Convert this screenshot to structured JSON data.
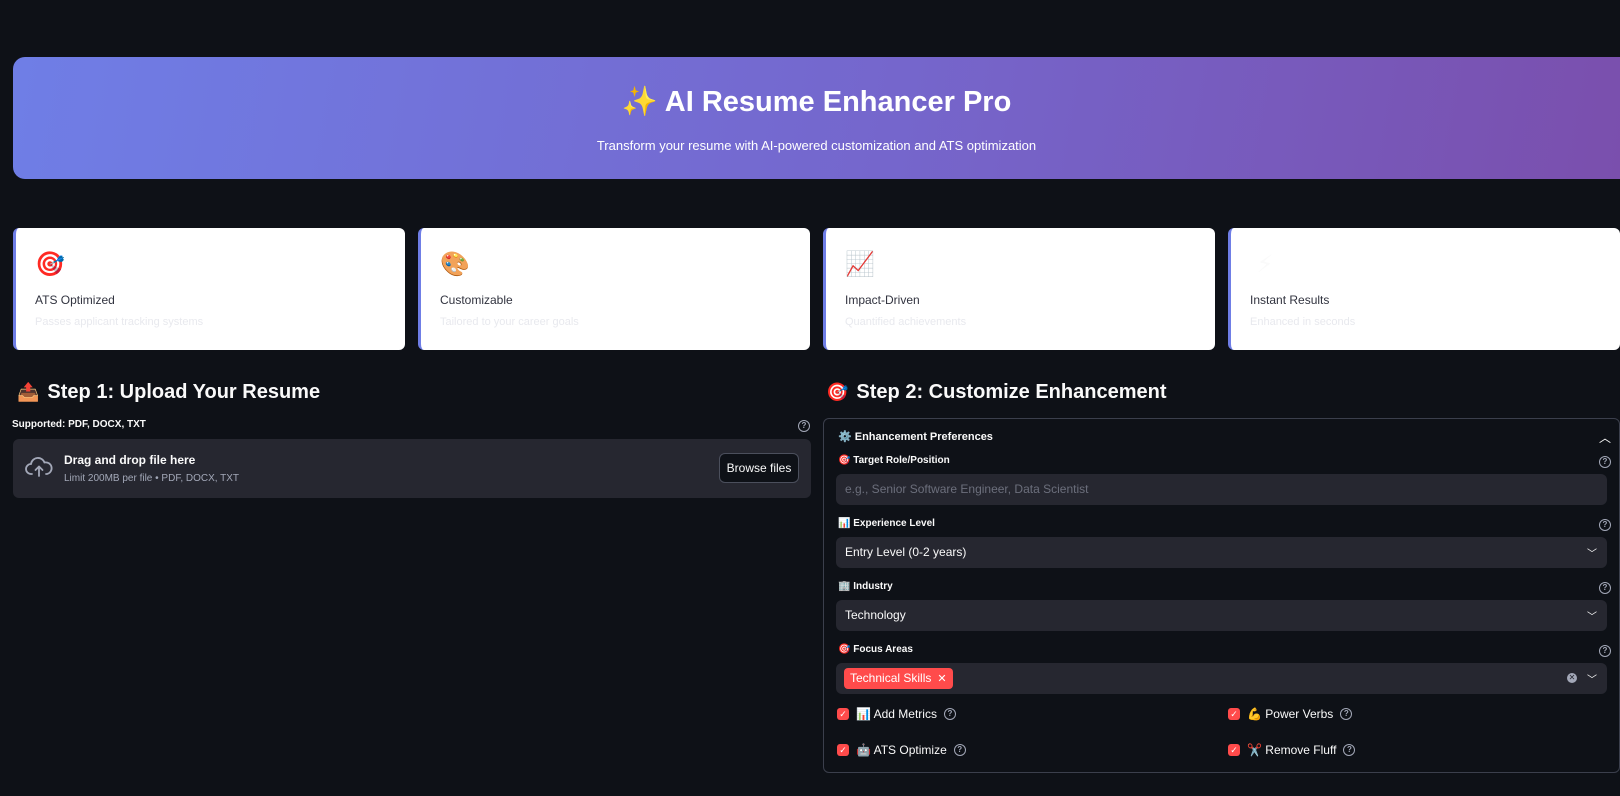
{
  "hero": {
    "title": "✨ AI Resume Enhancer Pro",
    "subtitle": "Transform your resume with AI-powered customization and ATS optimization"
  },
  "features": [
    {
      "icon": "🎯",
      "icon_name": "target-icon",
      "title": "ATS Optimized",
      "desc": "Passes applicant tracking systems"
    },
    {
      "icon": "🎨",
      "icon_name": "palette-icon",
      "title": "Customizable",
      "desc": "Tailored to your career goals"
    },
    {
      "icon": "📈",
      "icon_name": "chart-up-icon",
      "title": "Impact-Driven",
      "desc": "Quantified achievements"
    },
    {
      "icon": "⚡",
      "icon_name": "lightning-icon",
      "title": "Instant Results",
      "desc": "Enhanced in seconds"
    }
  ],
  "step1": {
    "icon": "📤",
    "title": "Step 1: Upload Your Resume",
    "label": "Supported: PDF, DOCX, TXT",
    "drop_title": "Drag and drop file here",
    "drop_sub": "Limit 200MB per file • PDF, DOCX, TXT",
    "browse": "Browse files"
  },
  "step2": {
    "icon": "🎯",
    "title": "Step 2: Customize Enhancement",
    "expander": "⚙️ Enhancement Preferences",
    "role_label": "🎯 Target Role/Position",
    "role_placeholder": "e.g., Senior Software Engineer, Data Scientist",
    "exp_label": "📊 Experience Level",
    "exp_value": "Entry Level (0-2 years)",
    "industry_label": "🏢 Industry",
    "industry_value": "Technology",
    "focus_label": "🎯 Focus Areas",
    "focus_tags": [
      "Technical Skills"
    ],
    "checkboxes": [
      {
        "label": "📊 Add Metrics",
        "checked": true
      },
      {
        "label": "💪 Power Verbs",
        "checked": true
      },
      {
        "label": "🤖 ATS Optimize",
        "checked": true
      },
      {
        "label": "✂️ Remove Fluff",
        "checked": true
      }
    ]
  },
  "colors": {
    "background": "#0e1117",
    "accent": "#ff4b4b",
    "hero_start": "#6f7ee6",
    "hero_end": "#7a4fad"
  }
}
